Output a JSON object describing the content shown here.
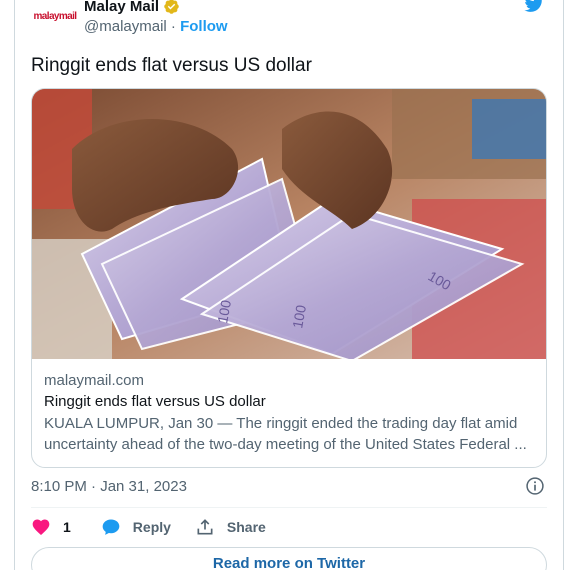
{
  "author": {
    "avatar_text": "malaymail",
    "display_name": "Malay Mail",
    "handle": "@malaymail",
    "separator": "·",
    "follow_label": "Follow",
    "verified_icon": "verified-badge-icon"
  },
  "tweet": {
    "text": "Ringgit ends flat versus US dollar"
  },
  "link_card": {
    "image_icon": "banknotes-photo",
    "domain": "malaymail.com",
    "title": "Ringgit ends flat versus US dollar",
    "description": "KUALA LUMPUR, Jan 30 — The ringgit ended the trading day flat amid uncertainty ahead of the two-day meeting of the United States Federal ...",
    "description_line1": "KUALA LUMPUR, Jan 30 — The ringgit ended the trading day flat amid",
    "description_line2": "uncertainty ahead of the two-day meeting of the United States Federal ..."
  },
  "meta": {
    "timestamp": "8:10 PM · Jan 31, 2023"
  },
  "actions": {
    "like_count": "1",
    "reply_label": "Reply",
    "share_label": "Share"
  },
  "footer": {
    "read_more_label": "Read more on Twitter"
  },
  "colors": {
    "accent": "#1d9bf0",
    "like": "#f91880",
    "verified": "#e2b719",
    "brand_red": "#c8102e"
  }
}
